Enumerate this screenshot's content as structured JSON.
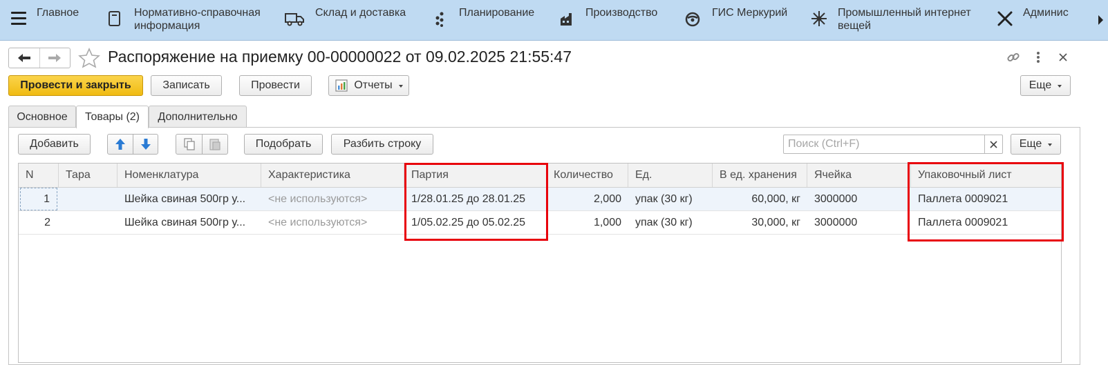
{
  "topbar": {
    "sections": [
      {
        "label": "Главное",
        "icon": "menu-icon"
      },
      {
        "label": "Нормативно-справочная информация",
        "icon": "reference-book-icon"
      },
      {
        "label": "Склад и доставка",
        "icon": "truck-icon"
      },
      {
        "label": "Планирование",
        "icon": "planning-dots-icon"
      },
      {
        "label": "Производство",
        "icon": "factory-icon"
      },
      {
        "label": "ГИС Меркурий",
        "icon": "mercury-icon"
      },
      {
        "label": "Промышленный интернет вещей",
        "icon": "iot-network-icon"
      },
      {
        "label": "Админис",
        "icon": "wrench-icon"
      }
    ]
  },
  "document": {
    "title": "Распоряжение на приемку 00-00000022 от 09.02.2025 21:55:47"
  },
  "toolbar": {
    "post_close": "Провести и закрыть",
    "save": "Записать",
    "post": "Провести",
    "reports": "Отчеты",
    "more": "Еще"
  },
  "tabs": [
    {
      "label": "Основное",
      "active": false
    },
    {
      "label": "Товары (2)",
      "active": true
    },
    {
      "label": "Дополнительно",
      "active": false
    }
  ],
  "goods_toolbar": {
    "add": "Добавить",
    "pick": "Подобрать",
    "split": "Разбить строку",
    "search_placeholder": "Поиск (Ctrl+F)",
    "more": "Еще"
  },
  "table": {
    "columns": [
      "N",
      "Тара",
      "Номенклатура",
      "Характеристика",
      "Партия",
      "Количество",
      "Ед.",
      "В ед. хранения",
      "Ячейка",
      "Упаковочный лист"
    ],
    "rows": [
      {
        "n": "1",
        "tara": "",
        "item": "Шейка свиная 500гр у...",
        "char": "<не используются>",
        "batch": "1/28.01.25 до 28.01.25",
        "qty": "2,000",
        "unit": "упак (30 кг)",
        "storage": "60,000, кг",
        "cell": "3000000",
        "pack": "Паллета 0009021"
      },
      {
        "n": "2",
        "tara": "",
        "item": "Шейка свиная 500гр у...",
        "char": "<не используются>",
        "batch": "1/05.02.25 до 05.02.25",
        "qty": "1,000",
        "unit": "упак (30 кг)",
        "storage": "30,000, кг",
        "cell": "3000000",
        "pack": "Паллета 0009021"
      }
    ]
  },
  "colors": {
    "topbar_bg": "#bfdaf2",
    "primary_button": "#f0bb12",
    "highlight": "#e8000b",
    "arrow_blue": "#2a7bd4"
  }
}
